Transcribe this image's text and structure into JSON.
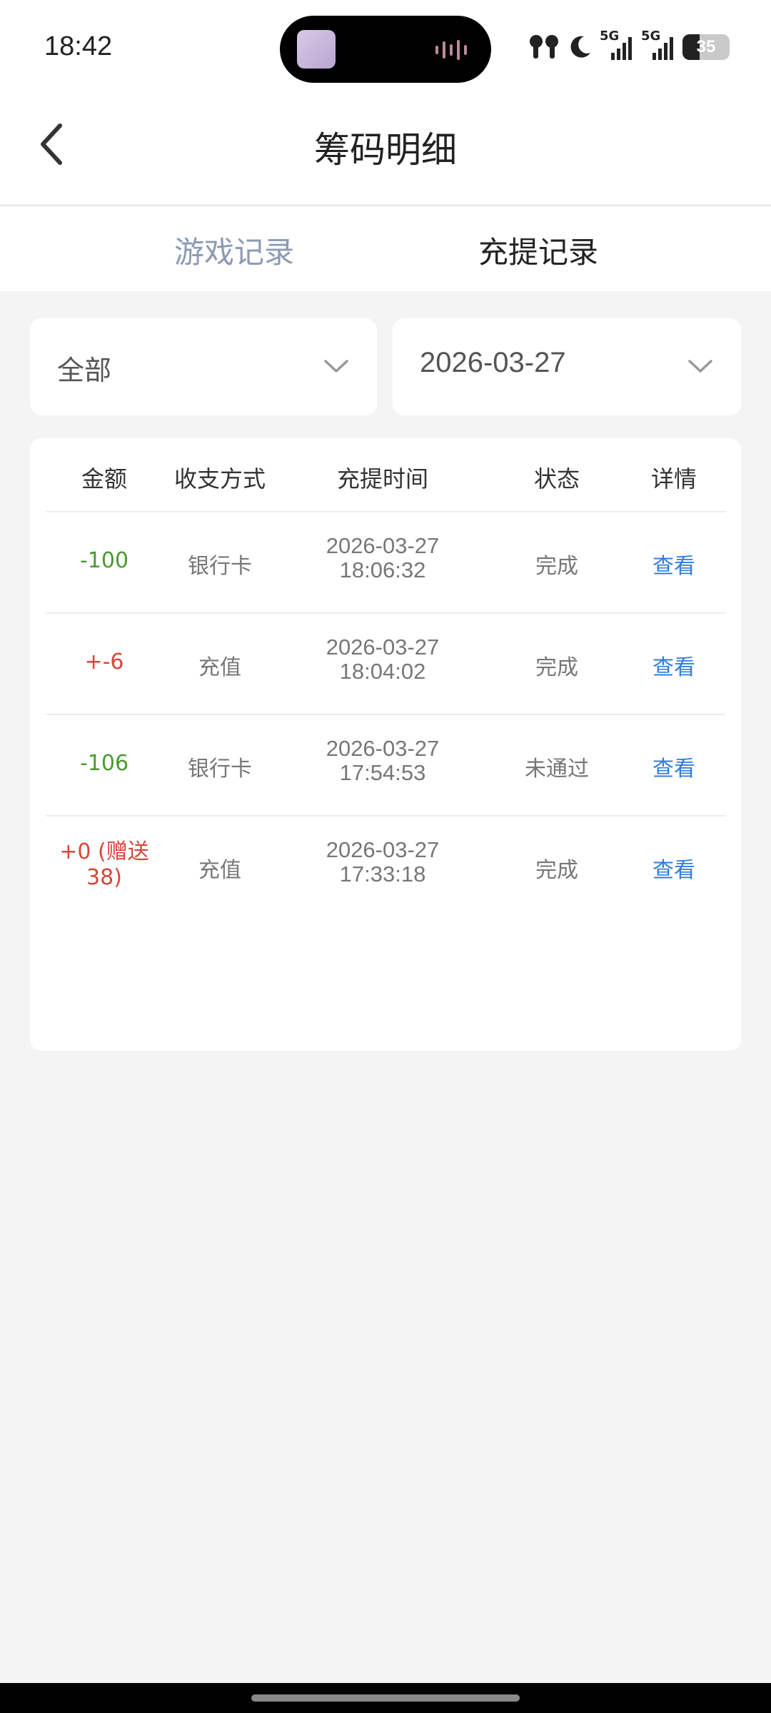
{
  "status_bar": {
    "time": "18:42",
    "network_1": "5G",
    "network_2": "5G",
    "battery": "35",
    "battery_level_percent": 35
  },
  "header": {
    "title": "筹码明细",
    "back_icon": "chevron-left-icon"
  },
  "tabs": [
    {
      "label": "游戏记录",
      "active": false
    },
    {
      "label": "充提记录",
      "active": true
    }
  ],
  "filters": {
    "type": "全部",
    "date": "2026-03-27"
  },
  "table": {
    "columns": [
      "金额",
      "收支方式",
      "充提时间",
      "状态",
      "详情"
    ],
    "rows": [
      {
        "amount": "-100",
        "method": "银行卡",
        "date": "2026-03-27",
        "time": "18:06:32",
        "status": "完成",
        "detail": "查看"
      },
      {
        "amount": "+-6",
        "method": "充值",
        "date": "2026-03-27",
        "time": "18:04:02",
        "status": "完成",
        "detail": "查看"
      },
      {
        "amount": "-106",
        "method": "银行卡",
        "date": "2026-03-27",
        "time": "17:54:53",
        "status": "未通过",
        "detail": "查看"
      },
      {
        "amount": "+0 (赠送38)",
        "method": "充值",
        "date": "2026-03-27",
        "time": "17:33:18",
        "status": "完成",
        "detail": "查看"
      }
    ]
  },
  "colors": {
    "negative": "#4a9a30",
    "positive": "#d9453a",
    "link": "#2f7de1",
    "inactive_tab": "#8d9bb3"
  }
}
